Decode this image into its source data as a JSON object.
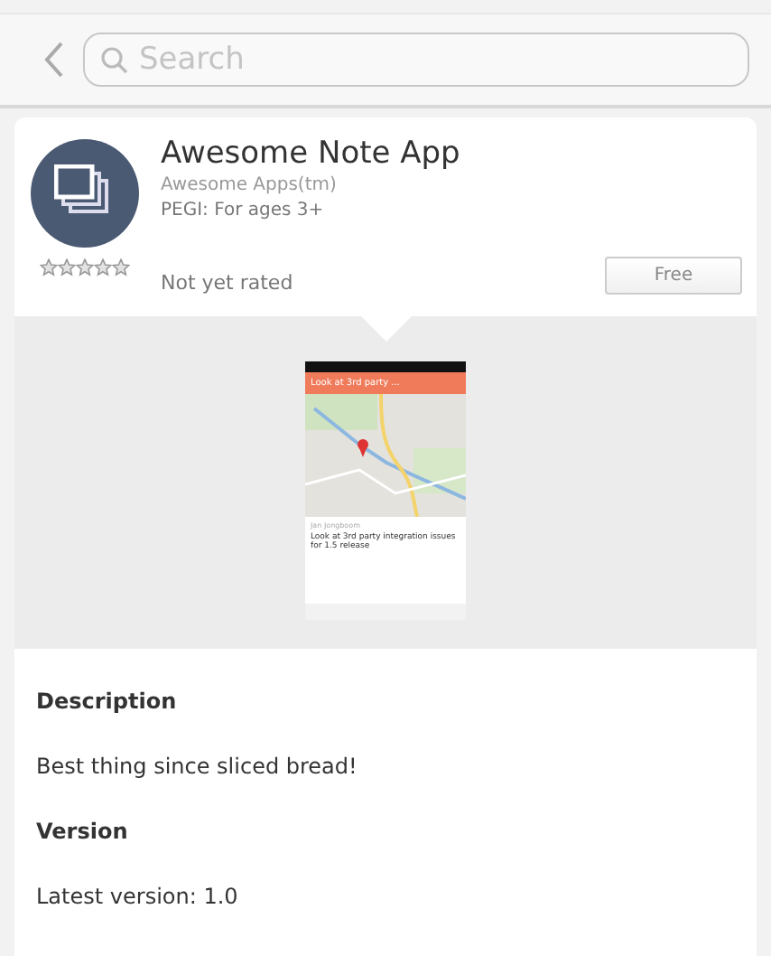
{
  "search": {
    "placeholder": "Search"
  },
  "app": {
    "name": "Awesome Note App",
    "publisher": "Awesome Apps(tm)",
    "rating_age": "PEGI: For ages 3+",
    "stars": 0,
    "rating_text": "Not yet rated",
    "price_button": "Free"
  },
  "screenshot": {
    "title": "Look at 3rd party ...",
    "author": "Jan Jongboom",
    "body": "Look at 3rd party integration issues for 1.5 release"
  },
  "sections": [
    {
      "kind": "heading",
      "text": "Description"
    },
    {
      "kind": "text",
      "text": "Best thing since sliced bread!"
    },
    {
      "kind": "heading",
      "text": "Version"
    },
    {
      "kind": "text",
      "text": "Latest version: 1.0"
    }
  ]
}
